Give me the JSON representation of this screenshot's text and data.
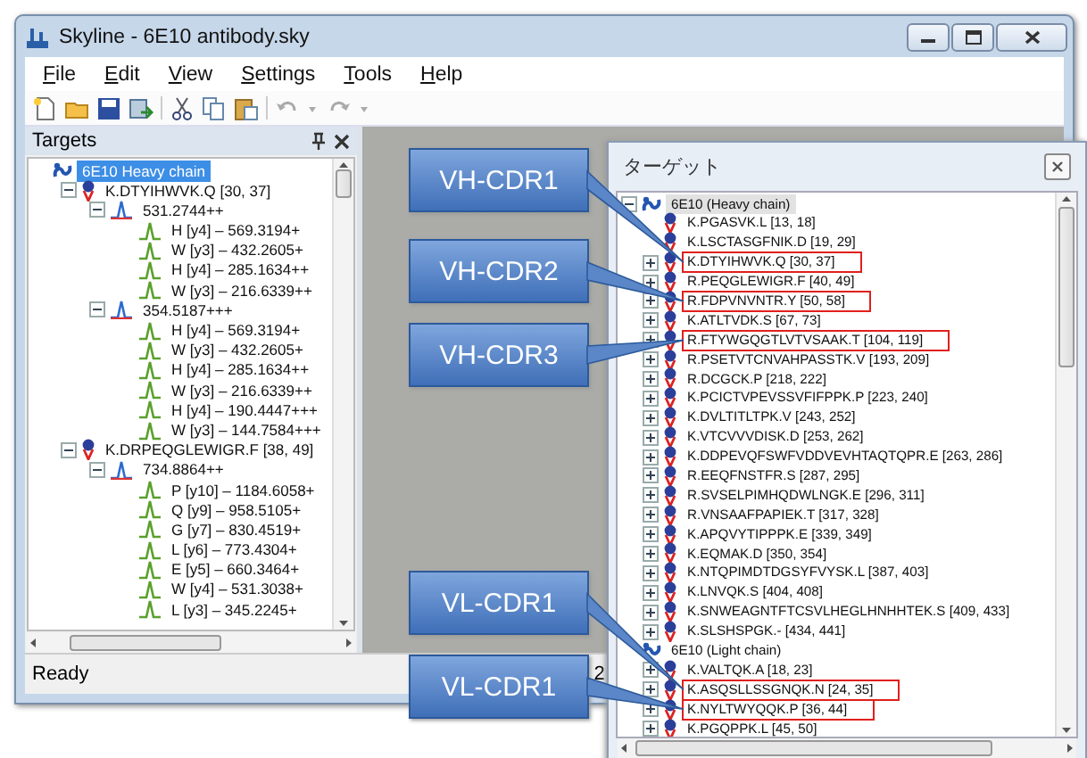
{
  "window": {
    "title": "Skyline - 6E10 antibody.sky"
  },
  "menu": [
    "File",
    "Edit",
    "View",
    "Settings",
    "Tools",
    "Help"
  ],
  "targets_panel": {
    "title": "Targets",
    "tree": [
      {
        "label": "6E10 Heavy chain",
        "kind": "protein",
        "selected": true,
        "children": [
          {
            "label": "K.DTYIHWVK.Q [30, 37]",
            "kind": "peptide",
            "selected": false,
            "expanded": true,
            "children": [
              {
                "label": "531.2744++",
                "kind": "precursor",
                "selected": false,
                "expanded": true,
                "children": [
                  {
                    "label": "H [y4] – 569.3194+",
                    "kind": "transition",
                    "selected": false
                  },
                  {
                    "label": "W [y3] – 432.2605+",
                    "kind": "transition",
                    "selected": false
                  },
                  {
                    "label": "H [y4] – 285.1634++",
                    "kind": "transition",
                    "selected": false
                  },
                  {
                    "label": "W [y3] – 216.6339++",
                    "kind": "transition",
                    "selected": false
                  }
                ]
              },
              {
                "label": "354.5187+++",
                "kind": "precursor",
                "selected": false,
                "expanded": true,
                "children": [
                  {
                    "label": "H [y4] – 569.3194+",
                    "kind": "transition",
                    "selected": false
                  },
                  {
                    "label": "W [y3] – 432.2605+",
                    "kind": "transition",
                    "selected": false
                  },
                  {
                    "label": "H [y4] – 285.1634++",
                    "kind": "transition",
                    "selected": false
                  },
                  {
                    "label": "W [y3] – 216.6339++",
                    "kind": "transition",
                    "selected": false
                  },
                  {
                    "label": "H [y4] – 190.4447+++",
                    "kind": "transition",
                    "selected": false
                  },
                  {
                    "label": "W [y3] – 144.7584+++",
                    "kind": "transition",
                    "selected": false
                  }
                ]
              }
            ]
          },
          {
            "label": "K.DRPEQGLEWIGR.F [38, 49]",
            "kind": "peptide",
            "selected": false,
            "expanded": true,
            "children": [
              {
                "label": "734.8864++",
                "kind": "precursor",
                "selected": false,
                "expanded": true,
                "children": [
                  {
                    "label": "P [y10] – 1184.6058+",
                    "kind": "transition",
                    "selected": false
                  },
                  {
                    "label": "Q [y9] – 958.5105+",
                    "kind": "transition",
                    "selected": false
                  },
                  {
                    "label": "G [y7] – 830.4519+",
                    "kind": "transition",
                    "selected": false
                  },
                  {
                    "label": "L [y6] – 773.4304+",
                    "kind": "transition",
                    "selected": false
                  },
                  {
                    "label": "E [y5] – 660.3464+",
                    "kind": "transition",
                    "selected": false
                  },
                  {
                    "label": "W [y4] – 531.3038+",
                    "kind": "transition",
                    "selected": false
                  },
                  {
                    "label": "L [y3] – 345.2245+",
                    "kind": "transition",
                    "selected": false
                  }
                ]
              }
            ]
          }
        ]
      }
    ]
  },
  "status_bar": {
    "text": "Ready",
    "panel_2": "2"
  },
  "jp_panel": {
    "title": "ターゲット",
    "tree": [
      {
        "label": "6E10 (Heavy chain)",
        "kind": "protein",
        "selected": true,
        "expanded": true,
        "children": [
          {
            "label": "K.PGASVK.L [13, 18]",
            "kind": "peptide",
            "highlighted": false
          },
          {
            "label": "K.LSCTASGFNIK.D [19, 29]",
            "kind": "peptide",
            "highlighted": false
          },
          {
            "label": "K.DTYIHWVK.Q [30, 37]",
            "kind": "peptide",
            "highlighted": true,
            "expanded": false
          },
          {
            "label": "R.PEQGLEWIGR.F [40, 49]",
            "kind": "peptide",
            "highlighted": false,
            "expanded": false
          },
          {
            "label": "R.FDPVNVNTR.Y [50, 58]",
            "kind": "peptide",
            "highlighted": true,
            "expanded": false
          },
          {
            "label": "K.ATLTVDK.S [67, 73]",
            "kind": "peptide",
            "highlighted": false,
            "expanded": false
          },
          {
            "label": "R.FTYWGQGTLVTVSAAK.T [104, 119]",
            "kind": "peptide",
            "highlighted": true,
            "expanded": false
          },
          {
            "label": "R.PSETVTCNVAHPASSTK.V [193, 209]",
            "kind": "peptide",
            "highlighted": false,
            "expanded": false
          },
          {
            "label": "R.DCGCK.P [218, 222]",
            "kind": "peptide",
            "highlighted": false,
            "expanded": false
          },
          {
            "label": "K.PCICTVPEVSSVFIFPPK.P [223, 240]",
            "kind": "peptide",
            "highlighted": false,
            "expanded": false
          },
          {
            "label": "K.DVLTITLTPK.V [243, 252]",
            "kind": "peptide",
            "highlighted": false,
            "expanded": false
          },
          {
            "label": "K.VTCVVVDISK.D [253, 262]",
            "kind": "peptide",
            "highlighted": false,
            "expanded": false
          },
          {
            "label": "K.DDPEVQFSWFVDDVEVHTAQTQPR.E [263, 286]",
            "kind": "peptide",
            "highlighted": false,
            "expanded": false
          },
          {
            "label": "R.EEQFNSTFR.S [287, 295]",
            "kind": "peptide",
            "highlighted": false,
            "expanded": false
          },
          {
            "label": "R.SVSELPIMHQDWLNGK.E [296, 311]",
            "kind": "peptide",
            "highlighted": false,
            "expanded": false
          },
          {
            "label": "R.VNSAAFPAPIEK.T [317, 328]",
            "kind": "peptide",
            "highlighted": false,
            "expanded": false
          },
          {
            "label": "K.APQVYTIPPPK.E [339, 349]",
            "kind": "peptide",
            "highlighted": false,
            "expanded": false
          },
          {
            "label": "K.EQMAK.D [350, 354]",
            "kind": "peptide",
            "highlighted": false,
            "expanded": false
          },
          {
            "label": "K.NTQPIMDTDGSYFVYSK.L [387, 403]",
            "kind": "peptide",
            "highlighted": false,
            "expanded": false
          },
          {
            "label": "K.LNVQK.S [404, 408]",
            "kind": "peptide",
            "highlighted": false,
            "expanded": false
          },
          {
            "label": "K.SNWEAGNTFTCSVLHEGLHNHHTEK.S [409, 433]",
            "kind": "peptide",
            "highlighted": false,
            "expanded": false
          },
          {
            "label": "K.SLSHSPGK.- [434, 441]",
            "kind": "peptide",
            "highlighted": false,
            "expanded": false
          }
        ]
      },
      {
        "label": "6E10 (Light chain)",
        "kind": "protein",
        "selected": false,
        "children": [
          {
            "label": "K.VALTQK.A [18, 23]",
            "kind": "peptide",
            "highlighted": false,
            "expanded": false
          },
          {
            "label": "K.ASQSLLSSGNQK.N [24, 35]",
            "kind": "peptide",
            "highlighted": true,
            "expanded": false
          },
          {
            "label": "K.NYLTWYQQK.P [36, 44]",
            "kind": "peptide",
            "highlighted": true,
            "expanded": false
          },
          {
            "label": "K.PGQPPK.L [45, 50]",
            "kind": "peptide",
            "highlighted": false,
            "expanded": false
          }
        ]
      }
    ]
  },
  "callouts": [
    {
      "label": "VH-CDR1"
    },
    {
      "label": "VH-CDR2"
    },
    {
      "label": "VH-CDR3"
    },
    {
      "label": "VL-CDR1"
    },
    {
      "label": "VL-CDR1"
    }
  ]
}
